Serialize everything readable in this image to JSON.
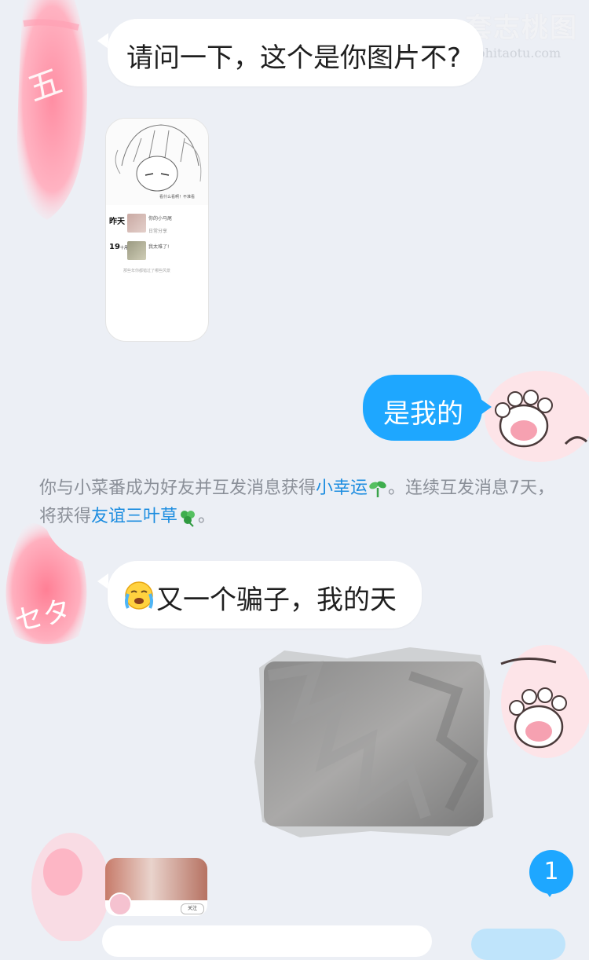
{
  "watermark": {
    "site_cn": "套志桃图",
    "site_url": "taohitaotu.com"
  },
  "messages": {
    "m1_text": "请问一下，这个是你图片不?",
    "shared_card": {
      "caption": "看什么看啊！不准看",
      "day1_label": "昨天",
      "item1_text": "你的小马尾",
      "item1_sub": "日常分享",
      "day2_label": "19",
      "day2_unit": "十月",
      "item2_text": "我太难了!",
      "footer": "那些年你都错过了哪些风景"
    },
    "m2_text": "是我的",
    "system_notice": {
      "part1": "你与小菜番成为好友并互发消息获得",
      "link1": "小幸运",
      "part2": "。连续互发消息7天，将获得",
      "link2": "友谊三叶草",
      "part3": "。"
    },
    "m3_text": "又一个骗子，我的天",
    "m4_preview": {
      "button_label": "关注"
    }
  },
  "avatars": {
    "left_1_text": "五",
    "left_2_text": "セタ"
  },
  "unread_badge": "1",
  "icons": [
    "sprout-icon",
    "clover-icon",
    "crying-emoji-icon",
    "paw-avatar-icon"
  ]
}
